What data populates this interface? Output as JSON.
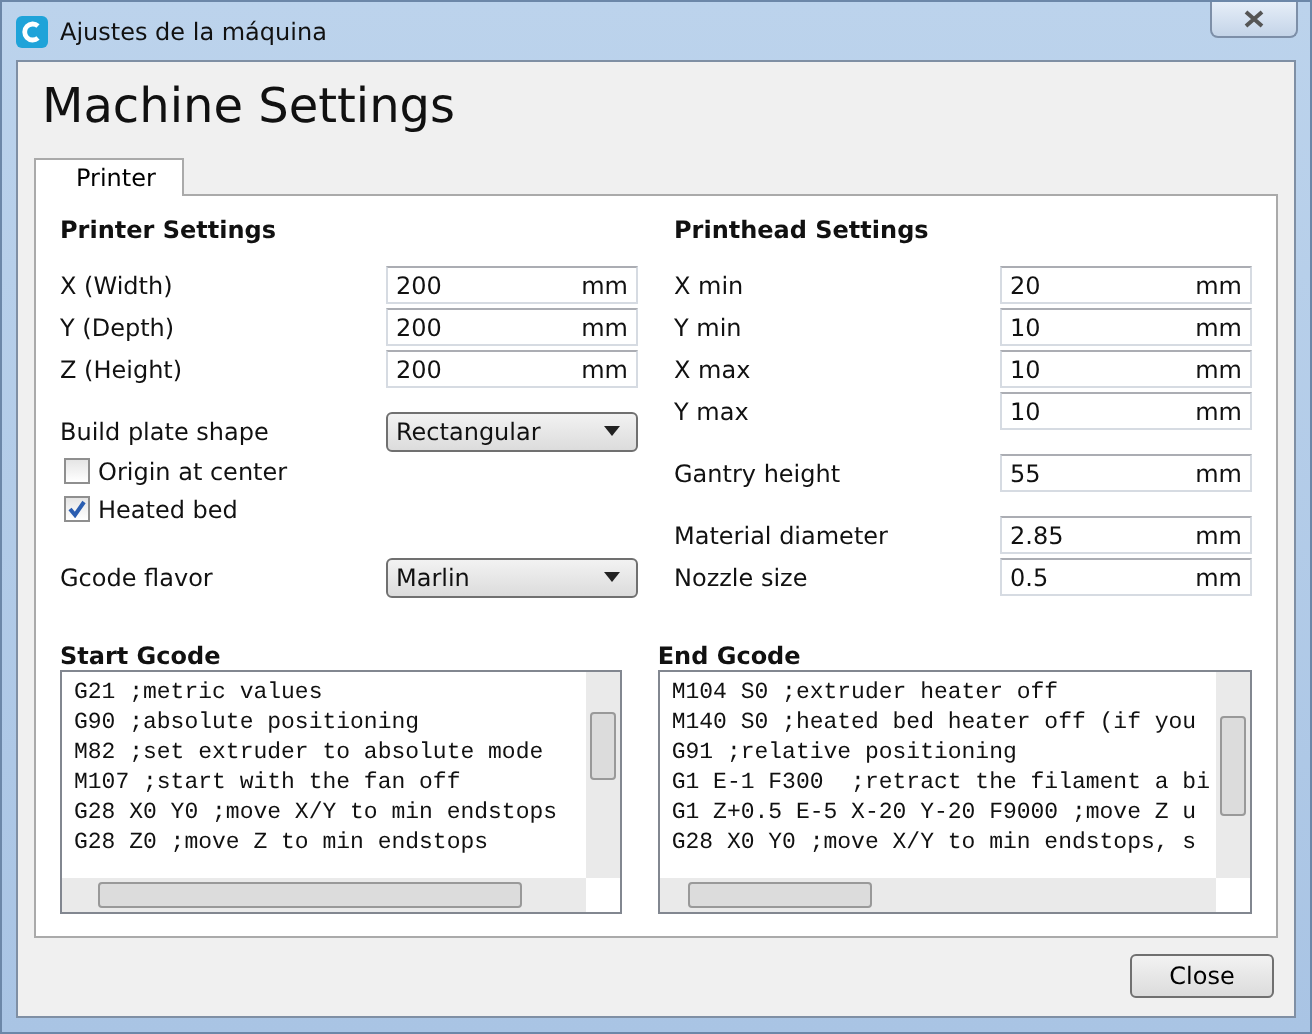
{
  "window": {
    "title": "Ajustes de la máquina"
  },
  "heading": "Machine Settings",
  "tabs": [
    {
      "label": "Printer",
      "selected": true
    }
  ],
  "printer_settings": {
    "title": "Printer Settings",
    "groups": [
      [
        {
          "label": "X (Width)",
          "value": "200",
          "unit": "mm"
        },
        {
          "label": "Y (Depth)",
          "value": "200",
          "unit": "mm"
        },
        {
          "label": "Z (Height)",
          "value": "200",
          "unit": "mm"
        }
      ]
    ],
    "build_plate_shape": {
      "label": "Build plate shape",
      "value": "Rectangular"
    },
    "checkboxes": [
      {
        "label": "Origin at center",
        "checked": false
      },
      {
        "label": "Heated bed",
        "checked": true
      }
    ],
    "gcode_flavor": {
      "label": "Gcode flavor",
      "value": "Marlin"
    }
  },
  "printhead_settings": {
    "title": "Printhead Settings",
    "groups": [
      [
        {
          "label": "X min",
          "value": "20",
          "unit": "mm"
        },
        {
          "label": "Y min",
          "value": "10",
          "unit": "mm"
        },
        {
          "label": "X max",
          "value": "10",
          "unit": "mm"
        },
        {
          "label": "Y max",
          "value": "10",
          "unit": "mm"
        }
      ],
      [
        {
          "label": "Gantry height",
          "value": "55",
          "unit": "mm"
        }
      ],
      [
        {
          "label": "Material diameter",
          "value": "2.85",
          "unit": "mm"
        },
        {
          "label": "Nozzle size",
          "value": "0.5",
          "unit": "mm"
        }
      ]
    ]
  },
  "gcode": [
    {
      "title": "Start Gcode",
      "lines": [
        "G21 ;metric values",
        "G90 ;absolute positioning",
        "M82 ;set extruder to absolute mode",
        "M107 ;start with the fan off",
        "G28 X0 Y0 ;move X/Y to min endstops",
        "G28 Z0 ;move Z to min endstops"
      ]
    },
    {
      "title": "End Gcode",
      "lines": [
        "M104 S0 ;extruder heater off",
        "M140 S0 ;heated bed heater off (if you",
        "G91 ;relative positioning",
        "G1 E-1 F300  ;retract the filament a bi",
        "G1 Z+0.5 E-5 X-20 Y-20 F9000 ;move Z u",
        "G28 X0 Y0 ;move X/Y to min endstops, s"
      ]
    }
  ],
  "buttons": [
    {
      "label": "Close"
    }
  ]
}
